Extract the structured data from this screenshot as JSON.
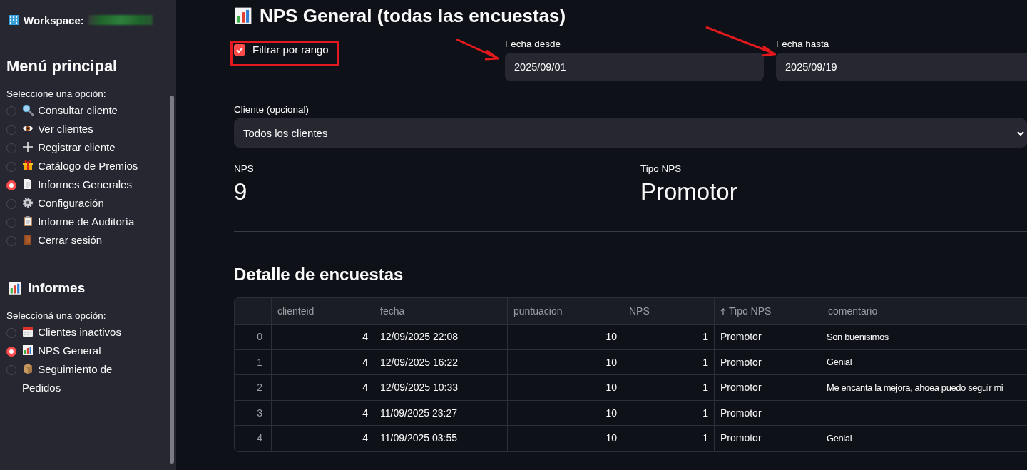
{
  "sidebar": {
    "workspace": {
      "label": "Workspace:"
    },
    "sections": [
      {
        "title": "Menú principal",
        "prompt": "Seleccione una opción:",
        "options": [
          {
            "label": "Consultar cliente",
            "selected": false
          },
          {
            "label": "Ver clientes",
            "selected": false
          },
          {
            "label": "Registrar cliente",
            "selected": false
          },
          {
            "label": "Catálogo de Premios",
            "selected": false
          },
          {
            "label": "Informes Generales",
            "selected": true
          },
          {
            "label": "Configuración",
            "selected": false
          },
          {
            "label": "Informe de Auditoría",
            "selected": false
          },
          {
            "label": "Cerrar sesión",
            "selected": false
          }
        ]
      },
      {
        "title": "Informes",
        "prompt": "Seleccioná una opción:",
        "options": [
          {
            "label": "Clientes inactivos",
            "selected": false
          },
          {
            "label": "NPS General",
            "selected": true
          },
          {
            "label": "Seguimiento de Pedidos",
            "selected": false
          }
        ]
      }
    ]
  },
  "page": {
    "title": "NPS General (todas las encuestas)",
    "filter": {
      "label": "Filtrar por rango",
      "checked": true
    },
    "date_from": {
      "label": "Fecha desde",
      "value": "2025/09/01"
    },
    "date_to": {
      "label": "Fecha hasta",
      "value": "2025/09/19"
    },
    "client": {
      "label": "Cliente (opcional)",
      "value": "Todos los clientes"
    },
    "metrics": [
      {
        "label": "NPS",
        "value": "9"
      },
      {
        "label": "Tipo NPS",
        "value": "Promotor"
      }
    ],
    "detail_title": "Detalle de encuestas",
    "table": {
      "columns": [
        {
          "label": "clienteid",
          "kind": "number",
          "sorted": false
        },
        {
          "label": "fecha",
          "kind": "text",
          "sorted": false
        },
        {
          "label": "puntuacion",
          "kind": "number",
          "sorted": false
        },
        {
          "label": "NPS",
          "kind": "number",
          "sorted": false
        },
        {
          "label": "Tipo NPS",
          "kind": "text",
          "sorted": true
        },
        {
          "label": "comentario",
          "kind": "text",
          "sorted": false
        }
      ],
      "rows": [
        {
          "index": "0",
          "cells": [
            "4",
            "12/09/2025 22:08",
            "10",
            "1",
            "Promotor",
            "Son buenisimos"
          ]
        },
        {
          "index": "1",
          "cells": [
            "4",
            "12/09/2025 16:22",
            "10",
            "1",
            "Promotor",
            "Genial"
          ]
        },
        {
          "index": "2",
          "cells": [
            "4",
            "12/09/2025 10:33",
            "10",
            "1",
            "Promotor",
            "Me encanta la mejora, ahoea puedo seguir mi"
          ]
        },
        {
          "index": "3",
          "cells": [
            "4",
            "11/09/2025 23:27",
            "10",
            "1",
            "Promotor",
            null
          ]
        },
        {
          "index": "4",
          "cells": [
            "4",
            "11/09/2025 03:55",
            "10",
            "1",
            "Promotor",
            "Genial"
          ]
        }
      ]
    }
  }
}
